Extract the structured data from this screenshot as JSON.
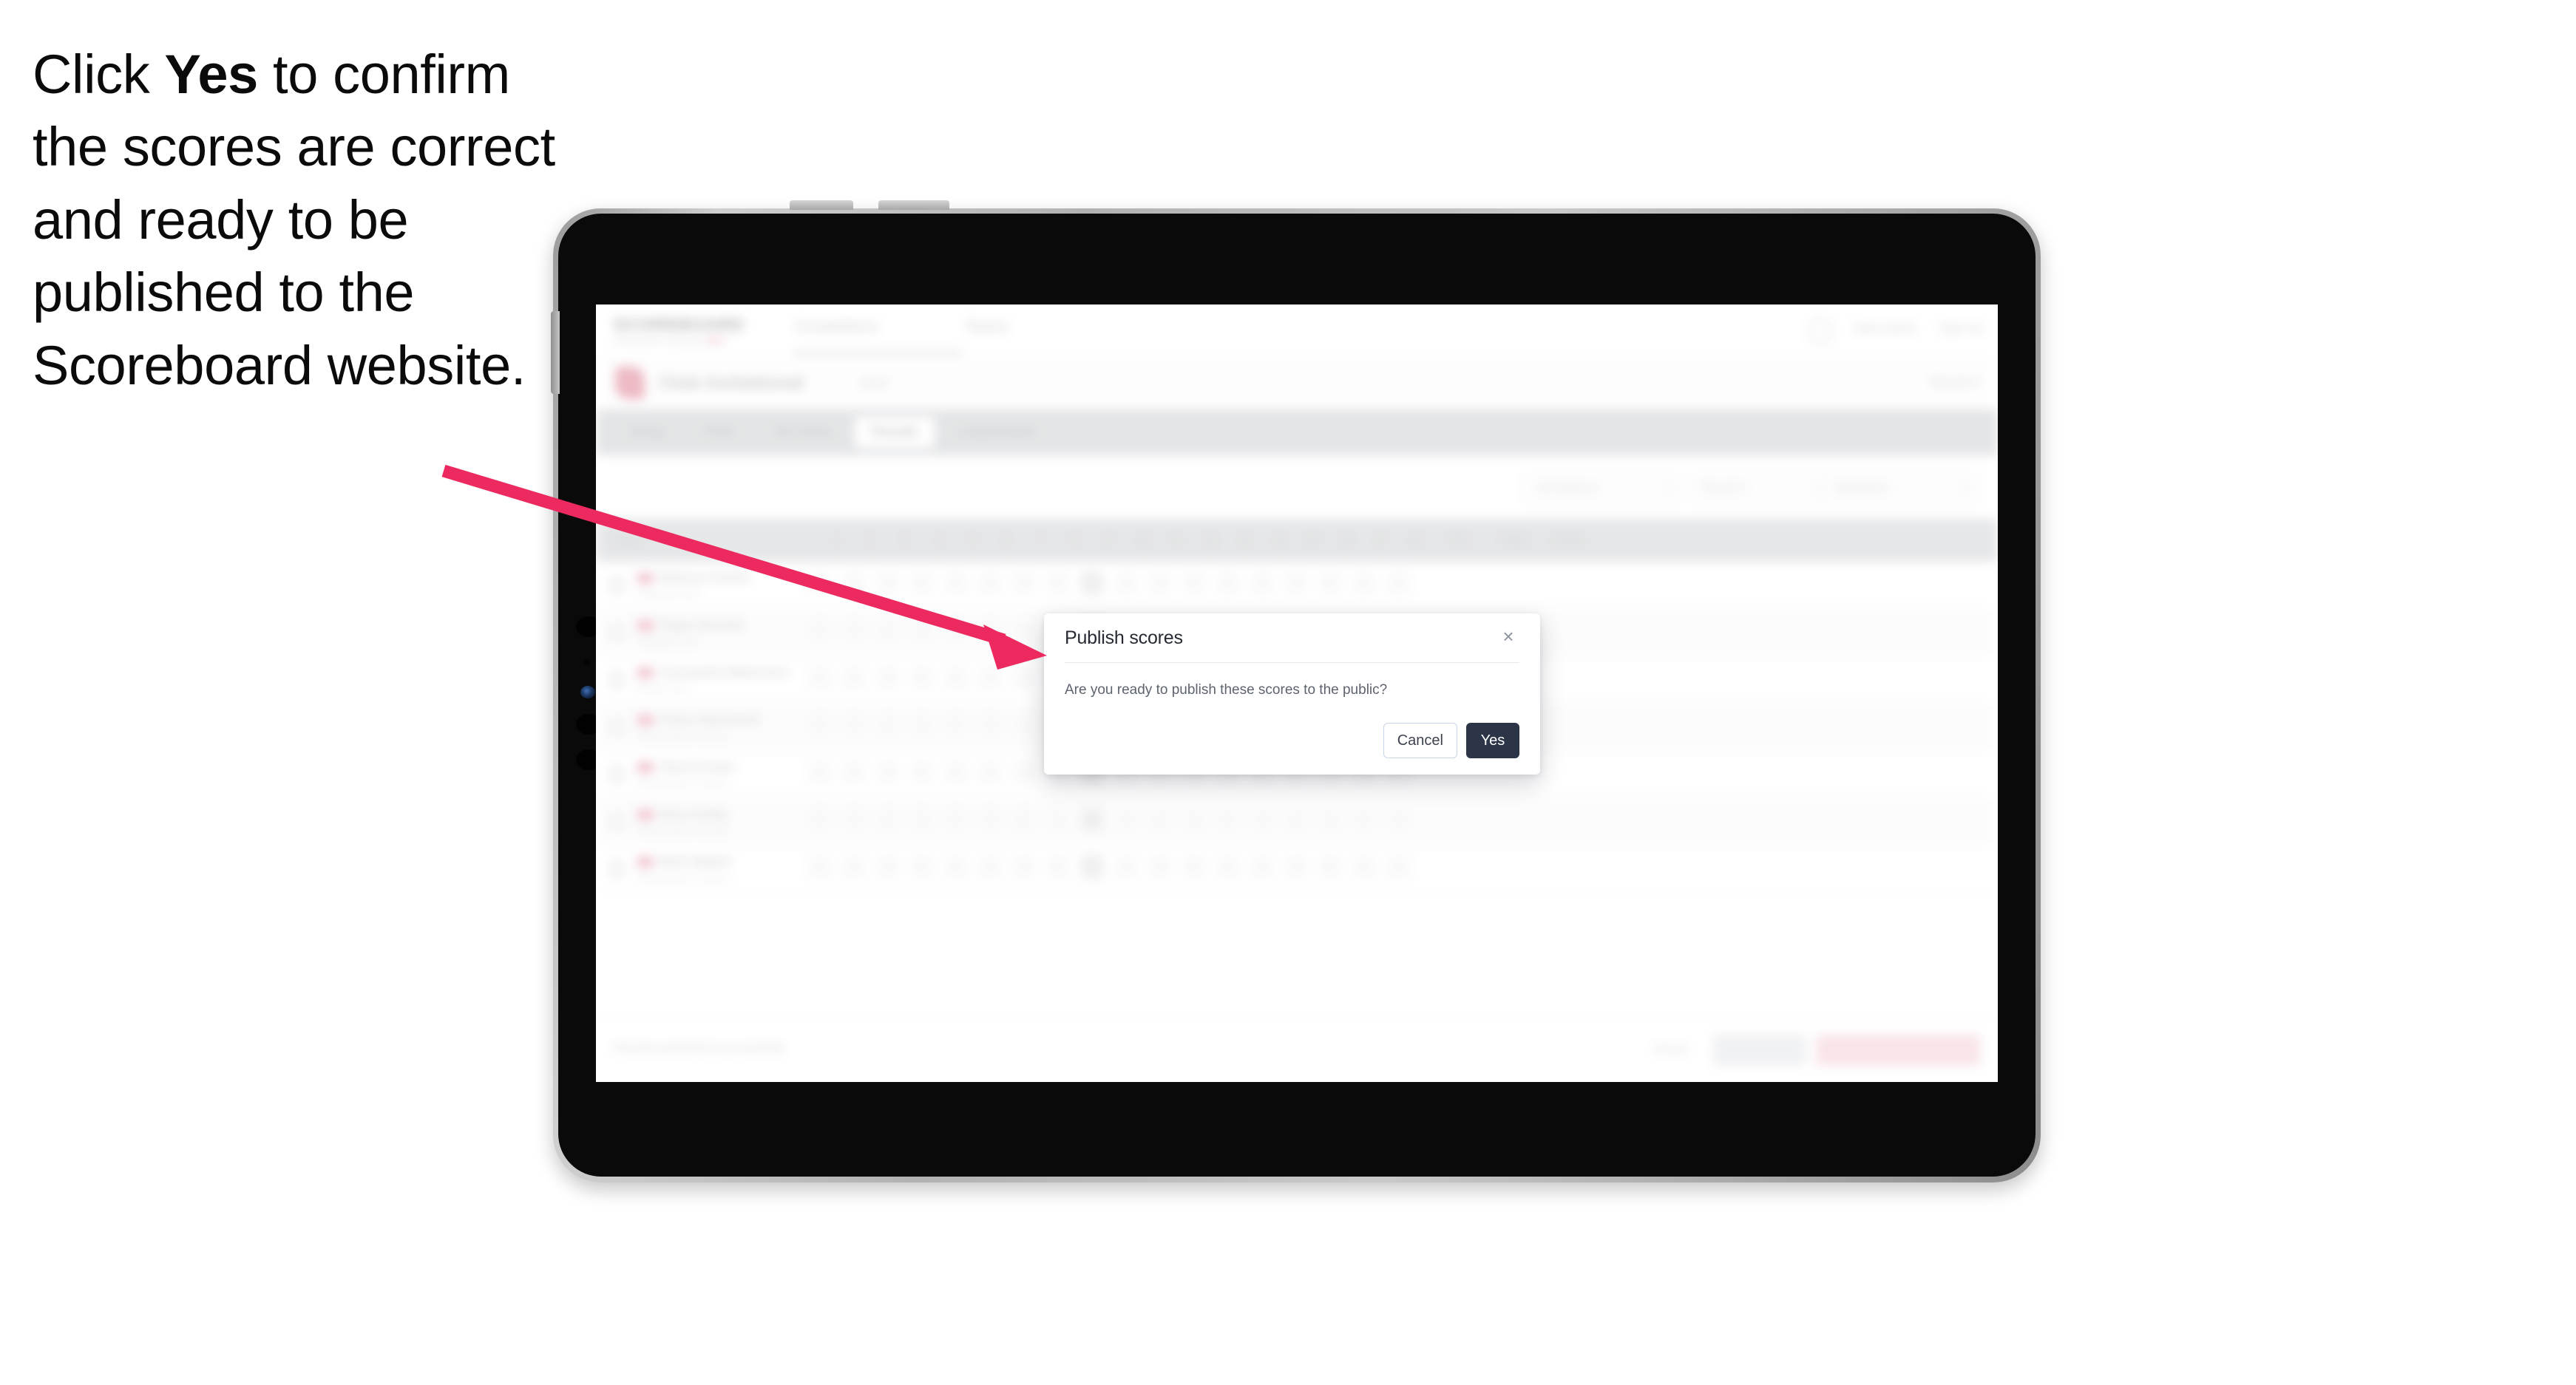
{
  "instruction": {
    "before": "Click ",
    "emphasis": "Yes",
    "after": " to confirm the scores are correct and ready to be published to the Scoreboard website."
  },
  "annotation": {
    "arrow_color": "#ec2a60",
    "arrow_start": "600,637",
    "arrow_end": "1415,885"
  },
  "device": {
    "type": "tablet",
    "frame_color": "#b2b2b2",
    "bezel_color": "#0a0a0a"
  },
  "modal": {
    "title": "Publish scores",
    "body": "Are you ready to publish these scores to the public?",
    "close_icon": "×",
    "cancel_label": "Cancel",
    "yes_label": "Yes",
    "yes_color": "#2b3547",
    "cancel_border_color": "#c9d5ea"
  },
  "app": {
    "header": {
      "brand": "SCOREBOARD",
      "brand_sub_text": "Tournament scoring by",
      "brand_sub_accent": "Golf",
      "nav": [
        {
          "label": "Competitions"
        },
        {
          "label": "Teams"
        }
      ],
      "user_label": "Main Admin",
      "signout_label": "Sign out",
      "account_icon": "user-avatar-icon"
    },
    "competition": {
      "name": "Club Invitational",
      "meta": "2024",
      "right_meta": "Round 2"
    },
    "tabs": [
      {
        "label": "Setup",
        "active": false
      },
      {
        "label": "Field",
        "active": false
      },
      {
        "label": "Tee times",
        "active": false
      },
      {
        "label": "Results",
        "active": true
      },
      {
        "label": "Leaderboard",
        "active": false
      }
    ],
    "filters": [
      {
        "label": "All divisions",
        "icon": "chevron-down-icon"
      },
      {
        "label": "Round 2",
        "icon": "chevron-down-icon"
      },
      {
        "label": "Stableford",
        "icon": "chevron-down-icon"
      }
    ],
    "table": {
      "columns": [
        "Player",
        "1",
        "2",
        "3",
        "4",
        "5",
        "6",
        "7",
        "8",
        "9",
        "10",
        "11",
        "12",
        "13",
        "14",
        "15",
        "16",
        "17",
        "18",
        "Out",
        "Total",
        "Points"
      ],
      "rows": [
        {
          "name": "Melissa Tomlin",
          "club": "Oaklands Golf"
        },
        {
          "name": "Pippa Norwell",
          "club": "Oaklands Golf"
        },
        {
          "name": "Cassandra Waterston",
          "club": "Bruton Park"
        },
        {
          "name": "Chloe Hammond",
          "club": "Ravensmere Country"
        },
        {
          "name": "Alexis Grant",
          "club": "Ravensmere Country"
        },
        {
          "name": "Nina Ashby",
          "club": "Ravensmere Country"
        },
        {
          "name": "Beth Walker",
          "club": "Ravensmere Country"
        }
      ]
    },
    "footer": {
      "note": "Results published successfully",
      "link_label": "Reset",
      "secondary_label": "Save",
      "primary_label": "Publish to Scoreboard"
    }
  }
}
